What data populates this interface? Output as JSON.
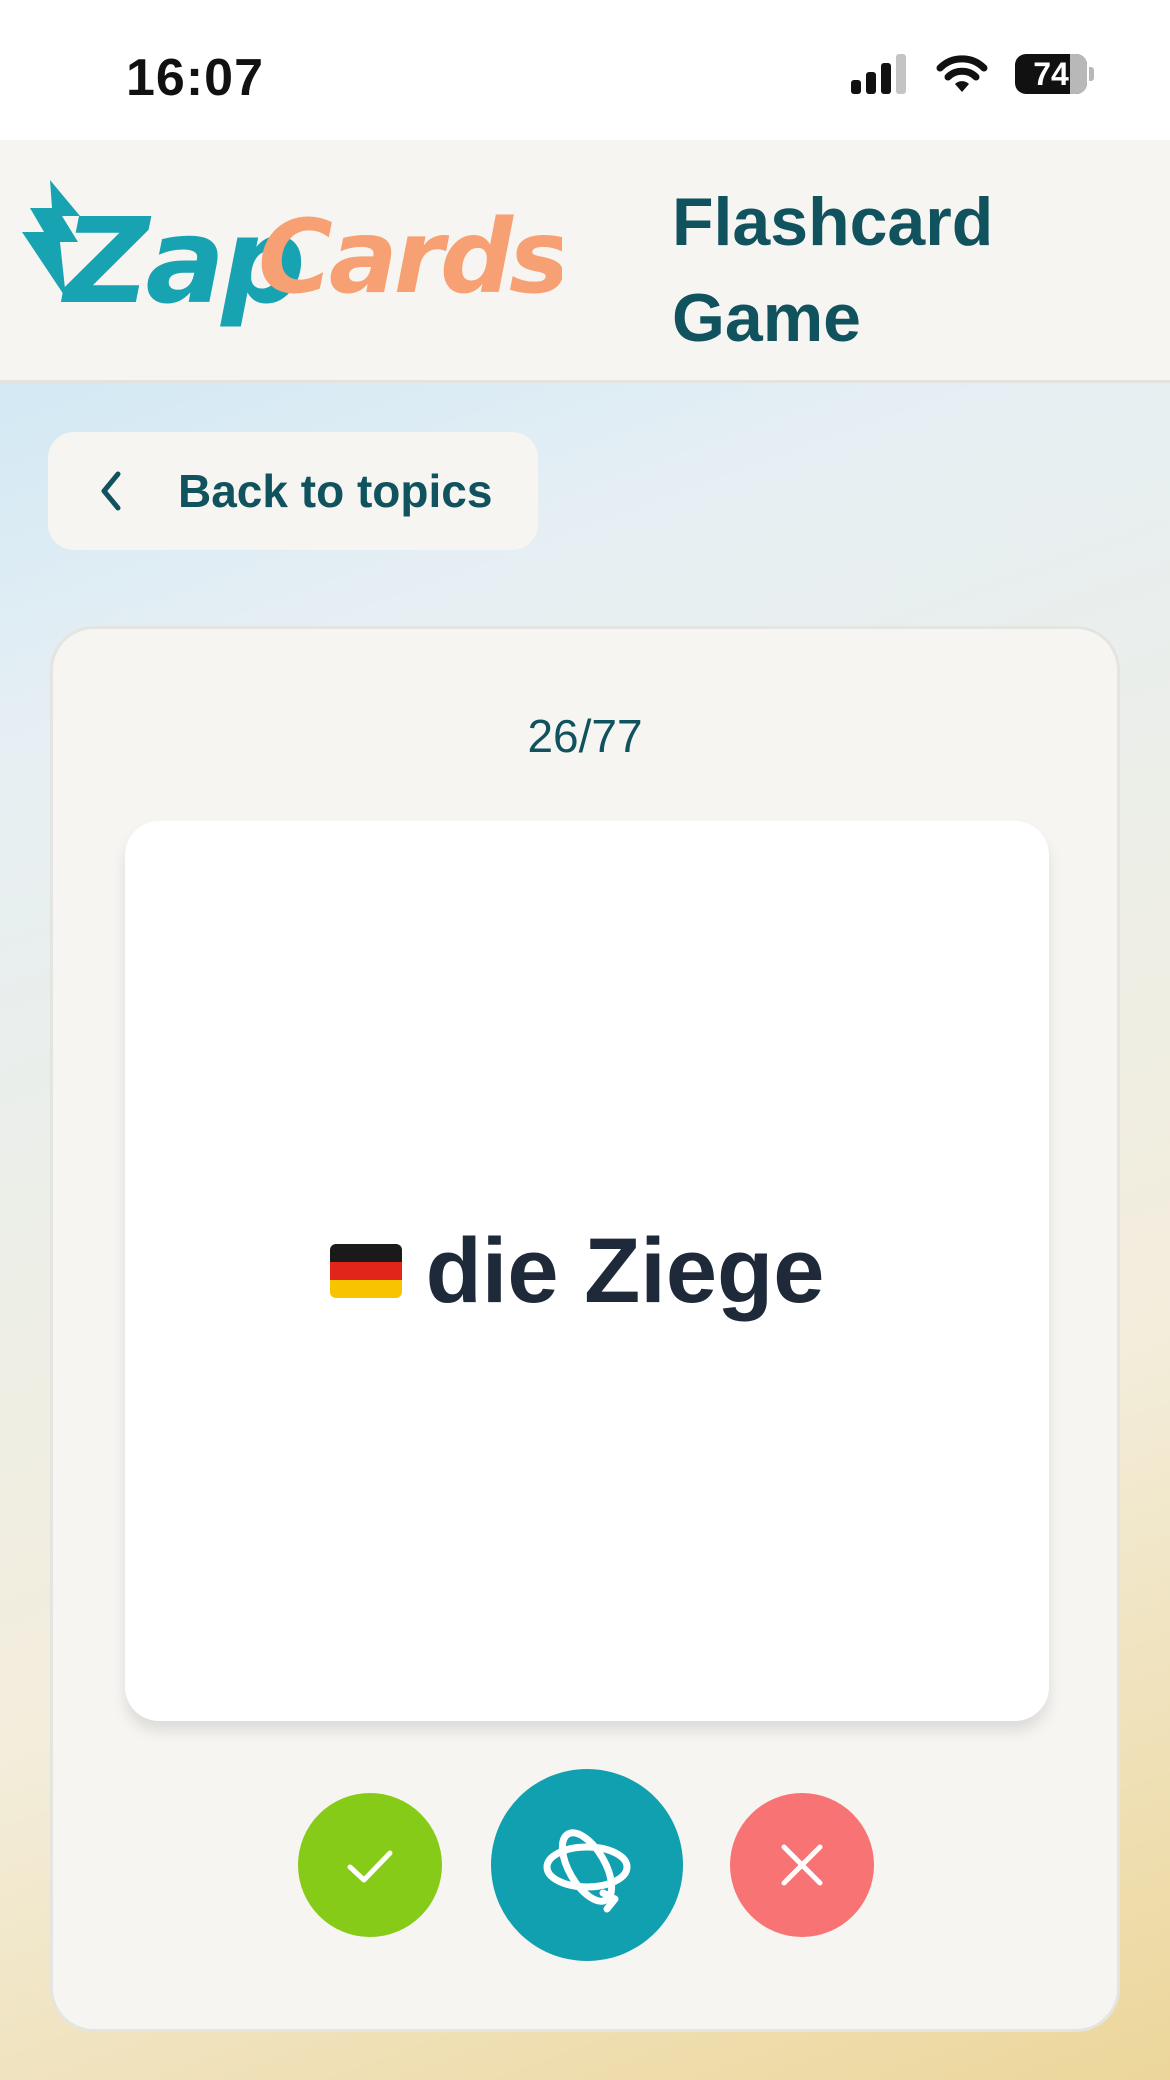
{
  "status_bar": {
    "time": "16:07",
    "battery": "74",
    "icons": [
      "cellular-signal-icon",
      "wifi-icon",
      "battery-icon"
    ]
  },
  "header": {
    "logo": {
      "part1": "Zap",
      "part2": "Cards"
    },
    "title": "Flashcard Game"
  },
  "back_button": {
    "label": "Back to topics",
    "icon": "chevron-left-icon"
  },
  "game": {
    "counter": "26/77",
    "card": {
      "flag": "german-flag-icon",
      "word": "die Ziege"
    },
    "controls": [
      {
        "name": "correct",
        "icon": "check-icon",
        "color": "#86cb17"
      },
      {
        "name": "flip",
        "icon": "flip-rotate-icon",
        "color": "#11a0b0"
      },
      {
        "name": "wrong",
        "icon": "close-icon",
        "color": "#f87373"
      }
    ]
  },
  "colors": {
    "brand_teal": "#17a3b1",
    "brand_orange": "#f7a073",
    "heading": "#10525d",
    "panel_bg": "#f6f5f2"
  }
}
